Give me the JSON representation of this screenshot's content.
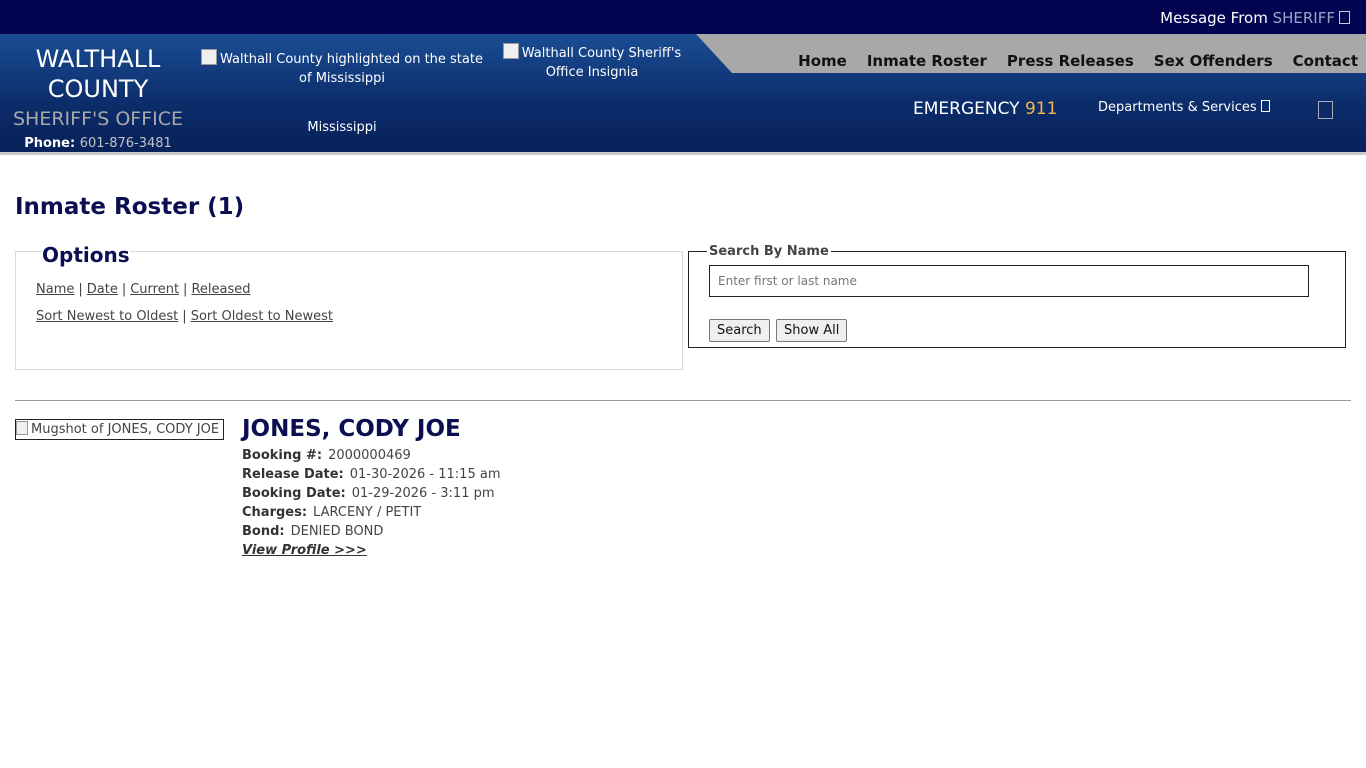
{
  "topbar": {
    "message_prefix": "Message From",
    "message_highlight": "SHERIFF"
  },
  "brand": {
    "line1": "WALTHALL",
    "line2": "COUNTY",
    "line3": "SHERIFF'S OFFICE",
    "phone_label": "Phone:",
    "phone_number": "601-876-3481"
  },
  "header_images": {
    "state_map_alt": "Walthall County highlighted on the state of Mississippi",
    "insignia_alt": "Walthall County Sheriff's Office Insignia",
    "state_label": "Mississippi"
  },
  "nav": {
    "items": [
      "Home",
      "Inmate Roster",
      "Press Releases",
      "Sex Offenders",
      "Contact"
    ]
  },
  "emergency": {
    "label": "EMERGENCY",
    "number": "911"
  },
  "departments": {
    "label": "Departments & Services"
  },
  "page": {
    "title": "Inmate Roster (1)"
  },
  "options": {
    "legend": "Options",
    "sort_links": [
      "Name",
      "Date",
      "Current",
      "Released"
    ],
    "order_links": [
      "Sort Newest to Oldest",
      "Sort Oldest to Newest"
    ]
  },
  "search": {
    "legend": "Search By Name",
    "placeholder": "Enter first or last name",
    "search_button": "Search",
    "show_all_button": "Show All"
  },
  "inmates": [
    {
      "mugshot_alt": "Mugshot of JONES, CODY JOE",
      "name": "JONES, CODY JOE",
      "booking_label": "Booking #:",
      "booking_number": "2000000469",
      "release_label": "Release Date:",
      "release_date": "01-30-2026 - 11:15 am",
      "booking_date_label": "Booking Date:",
      "booking_date": "01-29-2026 - 3:11 pm",
      "charges_label": "Charges:",
      "charges": "LARCENY / PETIT",
      "bond_label": "Bond:",
      "bond": "DENIED BOND",
      "view_profile": "View Profile >>>"
    }
  ],
  "colors": {
    "topbar": "#020452",
    "header": "#0c2c6a",
    "title": "#0b0f52",
    "emergency_number": "#f4b94a"
  }
}
